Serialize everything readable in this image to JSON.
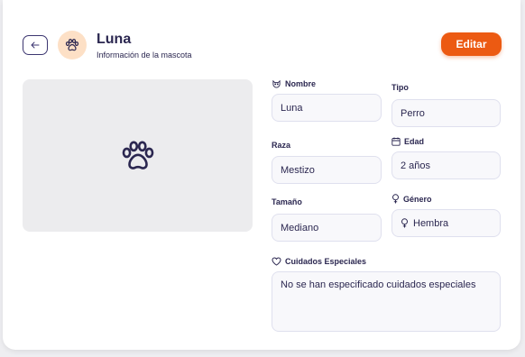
{
  "header": {
    "pet_name": "Luna",
    "subtitle": "Información de la mascota",
    "edit_label": "Editar"
  },
  "fields": {
    "nombre": {
      "label": "Nombre",
      "value": "Luna"
    },
    "tipo": {
      "label": "Tipo",
      "value": "Perro"
    },
    "raza": {
      "label": "Raza",
      "value": "Mestizo"
    },
    "edad": {
      "label": "Edad",
      "value": "2 años"
    },
    "tamano": {
      "label": "Tamaño",
      "value": "Mediano"
    },
    "genero": {
      "label": "Género",
      "value": "Hembra"
    },
    "cuidados": {
      "label": "Cuidados Especiales",
      "value": "No se han especificado cuidados especiales"
    }
  },
  "icons": {
    "back": "arrow-left-icon",
    "avatar": "paw-icon",
    "photo": "paw-icon",
    "nombre": "dog-icon",
    "edad": "calendar-icon",
    "genero": "female-icon",
    "cuidados": "heart-icon"
  },
  "colors": {
    "accent": "#ec5a12",
    "text": "#2b2750",
    "avatar_bg": "#fde0c6"
  }
}
